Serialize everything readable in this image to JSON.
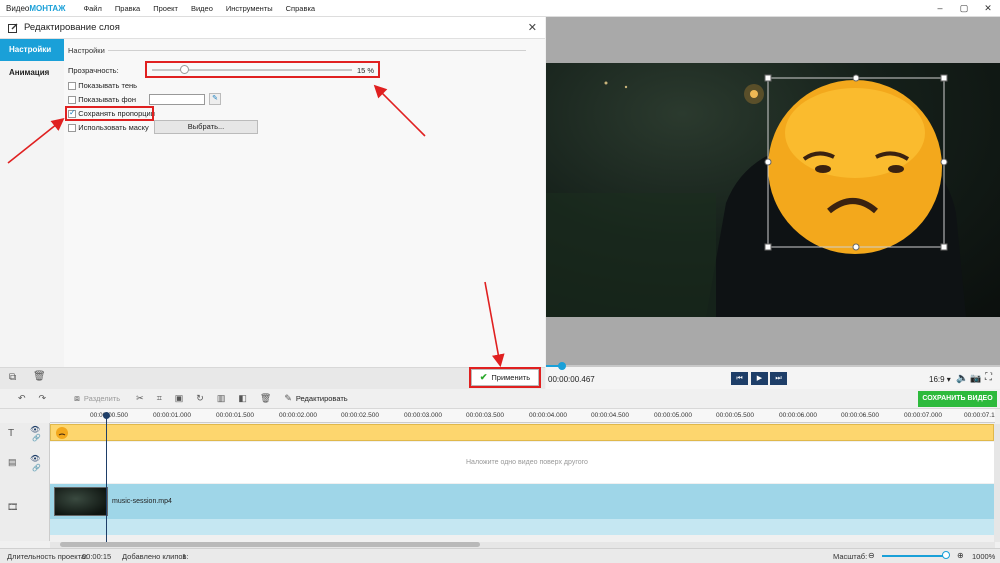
{
  "app": {
    "brand_prefix": "Видео",
    "brand_suffix": "МОНТАЖ"
  },
  "menu": [
    "Файл",
    "Правка",
    "Проект",
    "Видео",
    "Инструменты",
    "Справка"
  ],
  "panel": {
    "title": "Редактирование слоя",
    "tabs": [
      "Настройки",
      "Анимация"
    ],
    "section": "Настройки",
    "opacity_label": "Прозрачность:",
    "opacity_value": "15 %",
    "opacity_fraction": 0.15,
    "show_shadow": "Показывать тень",
    "show_bg": "Показывать фон",
    "keep_proportions": "Сохранять пропорции",
    "use_mask": "Использовать маску",
    "choose": "Выбрать...",
    "apply": "Применить"
  },
  "player": {
    "timecode": "00:00:00.467",
    "aspect": "16:9",
    "progress_fraction": 0.035
  },
  "timeline_toolbar": {
    "split": "Разделить",
    "edit": "Редактировать",
    "save": "СОХРАНИТЬ ВИДЕО"
  },
  "ruler": [
    "00:00:00.500",
    "00:00:01.000",
    "00:00:01.500",
    "00:00:02.000",
    "00:00:02.500",
    "00:00:03.000",
    "00:00:03.500",
    "00:00:04.000",
    "00:00:04.500",
    "00:00:05.000",
    "00:00:05.500",
    "00:00:06.000",
    "00:00:06.500",
    "00:00:07.000",
    "00:00:07.1"
  ],
  "tracks": {
    "overlay_hint": "Наложите одно видео поверх другого",
    "clip_name": "music-session.mp4"
  },
  "status": {
    "duration_label": "Длительность проекта:",
    "duration_value": "00:00:15",
    "clips_label": "Добавлено клипов:",
    "clips_value": "1",
    "scale_label": "Масштаб:",
    "scale_value": "1000%"
  },
  "colors": {
    "accent": "#1aa0d8",
    "highlight": "#e02020",
    "save": "#2dba3c",
    "overlay_track": "#fdd66e",
    "video_track": "#9fd6e8"
  }
}
